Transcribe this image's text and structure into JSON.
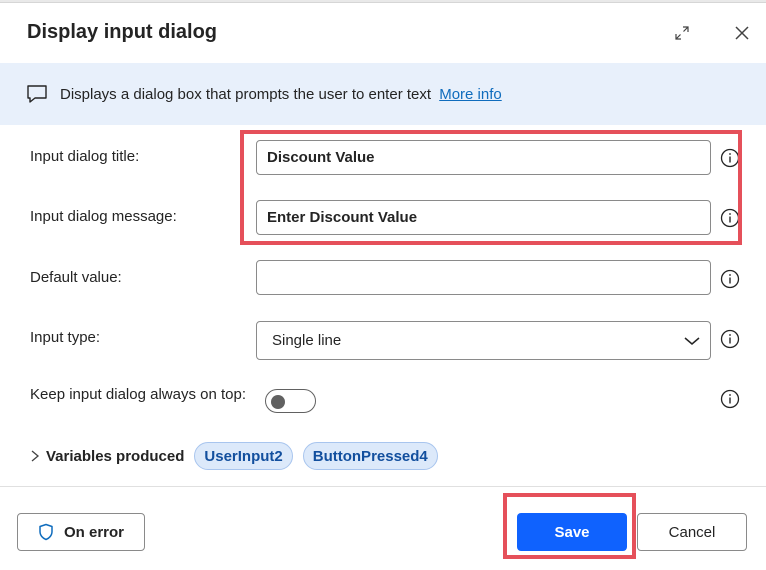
{
  "dialog": {
    "title": "Display input dialog",
    "expand_icon": "expand-icon",
    "close_icon": "close-icon"
  },
  "infobar": {
    "icon": "comment-icon",
    "text": "Displays a dialog box that prompts the user to enter text",
    "link": "More info"
  },
  "form": {
    "title_label": "Input dialog title:",
    "title_value": "Discount Value",
    "message_label": "Input dialog message:",
    "message_value": "Enter Discount Value",
    "default_label": "Default value:",
    "default_value": "",
    "type_label": "Input type:",
    "type_value": "Single line",
    "ontop_label": "Keep input dialog always on top:",
    "ontop_state": false
  },
  "variables": {
    "label": "Variables produced",
    "items": [
      "UserInput2",
      "ButtonPressed4"
    ]
  },
  "footer": {
    "on_error": "On error",
    "save": "Save",
    "cancel": "Cancel"
  },
  "colors": {
    "accent": "#0f62fe",
    "highlight": "#e5505a",
    "infobar": "#e8f0fb"
  }
}
